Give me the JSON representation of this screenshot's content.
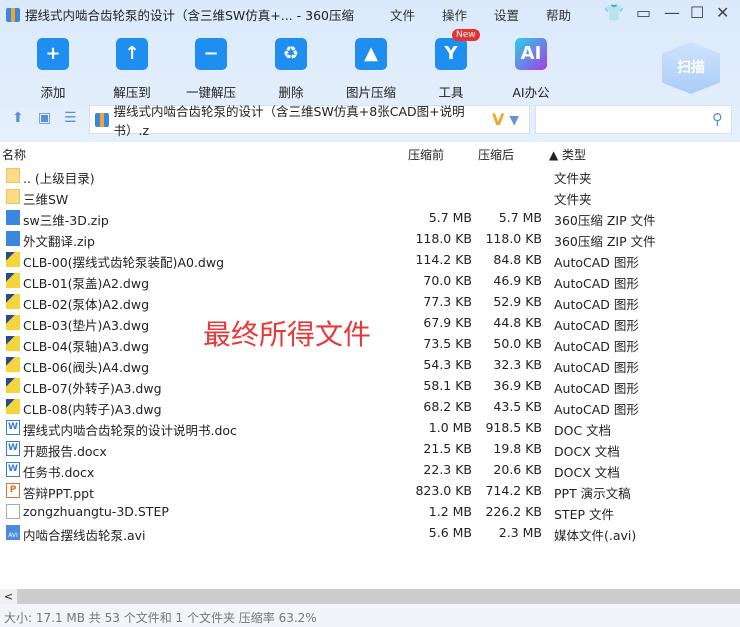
{
  "window": {
    "title": "摆线式内啮合齿轮泵的设计（含三维SW仿真+... - 360压缩",
    "menu": [
      "文件",
      "操作",
      "设置",
      "帮助"
    ]
  },
  "toolbar": [
    {
      "label": "添加",
      "glyph": "+"
    },
    {
      "label": "解压到",
      "glyph": "↑"
    },
    {
      "label": "一键解压",
      "glyph": "−"
    },
    {
      "label": "删除",
      "glyph": "♻"
    },
    {
      "label": "图片压缩",
      "glyph": "▲"
    },
    {
      "label": "工具",
      "glyph": "Y"
    },
    {
      "label": "AI办公",
      "glyph": "AI"
    }
  ],
  "new_badge": "New",
  "scan_label": "扫描",
  "path": "摆线式内啮合齿轮泵的设计（含三维SW仿真+8张CAD图+说明书）.z",
  "columns": {
    "name": "名称",
    "before": "压缩前",
    "after": "压缩后",
    "type": "▲ 类型"
  },
  "files": [
    {
      "name": ".. (上级目录)",
      "before": "",
      "after": "",
      "type": "文件夹",
      "icon": "folder"
    },
    {
      "name": "三维SW",
      "before": "",
      "after": "",
      "type": "文件夹",
      "icon": "folder"
    },
    {
      "name": "sw三维-3D.zip",
      "before": "5.7 MB",
      "after": "5.7 MB",
      "type": "360压缩 ZIP 文件",
      "icon": "zip"
    },
    {
      "name": "外文翻译.zip",
      "before": "118.0 KB",
      "after": "118.0 KB",
      "type": "360压缩 ZIP 文件",
      "icon": "zip"
    },
    {
      "name": "CLB-00(摆线式齿轮泵装配)A0.dwg",
      "before": "114.2 KB",
      "after": "84.8 KB",
      "type": "AutoCAD 图形",
      "icon": "dwg"
    },
    {
      "name": "CLB-01(泵盖)A2.dwg",
      "before": "70.0 KB",
      "after": "46.9 KB",
      "type": "AutoCAD 图形",
      "icon": "dwg"
    },
    {
      "name": "CLB-02(泵体)A2.dwg",
      "before": "77.3 KB",
      "after": "52.9 KB",
      "type": "AutoCAD 图形",
      "icon": "dwg"
    },
    {
      "name": "CLB-03(垫片)A3.dwg",
      "before": "67.9 KB",
      "after": "44.8 KB",
      "type": "AutoCAD 图形",
      "icon": "dwg"
    },
    {
      "name": "CLB-04(泵轴)A3.dwg",
      "before": "73.5 KB",
      "after": "50.0 KB",
      "type": "AutoCAD 图形",
      "icon": "dwg"
    },
    {
      "name": "CLB-06(阀头)A4.dwg",
      "before": "54.3 KB",
      "after": "32.3 KB",
      "type": "AutoCAD 图形",
      "icon": "dwg"
    },
    {
      "name": "CLB-07(外转子)A3.dwg",
      "before": "58.1 KB",
      "after": "36.9 KB",
      "type": "AutoCAD 图形",
      "icon": "dwg"
    },
    {
      "name": "CLB-08(内转子)A3.dwg",
      "before": "68.2 KB",
      "after": "43.5 KB",
      "type": "AutoCAD 图形",
      "icon": "dwg"
    },
    {
      "name": "摆线式内啮合齿轮泵的设计说明书.doc",
      "before": "1.0 MB",
      "after": "918.5 KB",
      "type": "DOC 文档",
      "icon": "doc"
    },
    {
      "name": "开题报告.docx",
      "before": "21.5 KB",
      "after": "19.8 KB",
      "type": "DOCX 文档",
      "icon": "doc"
    },
    {
      "name": "任务书.docx",
      "before": "22.3 KB",
      "after": "20.6 KB",
      "type": "DOCX 文档",
      "icon": "doc"
    },
    {
      "name": "答辩PPT.ppt",
      "before": "823.0 KB",
      "after": "714.2 KB",
      "type": "PPT 演示文稿",
      "icon": "ppt"
    },
    {
      "name": "zongzhuangtu-3D.STEP",
      "before": "1.2 MB",
      "after": "226.2 KB",
      "type": "STEP 文件",
      "icon": "step"
    },
    {
      "name": "内啮合摆线齿轮泵.avi",
      "before": "5.6 MB",
      "after": "2.3 MB",
      "type": "媒体文件(.avi)",
      "icon": "avi"
    }
  ],
  "overlay_text": "最终所得文件",
  "status": "大小: 17.1 MB 共 53 个文件和 1 个文件夹 压缩率 63.2%"
}
